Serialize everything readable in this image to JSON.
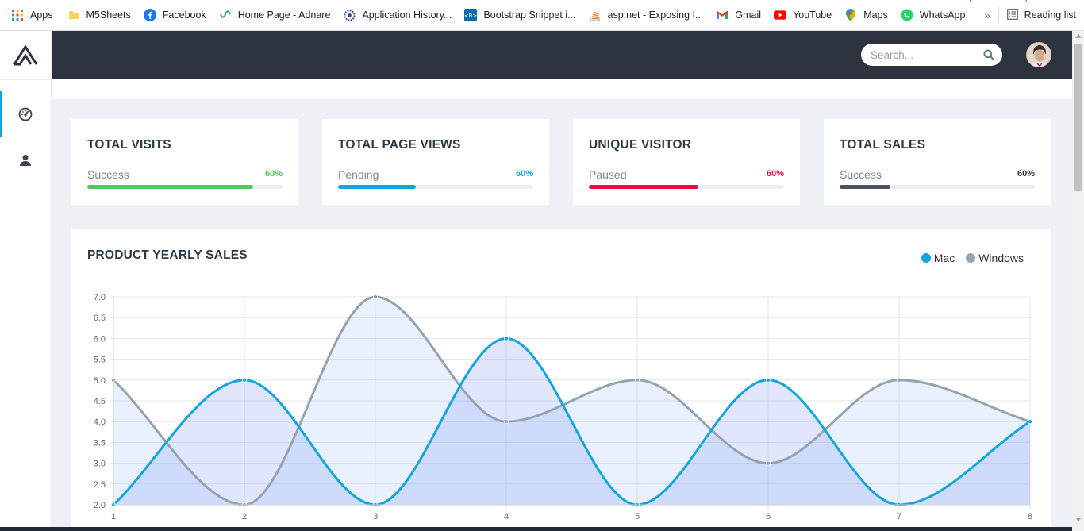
{
  "bookmarks": {
    "items": [
      {
        "label": "Apps",
        "icon": "apps-grid-icon"
      },
      {
        "label": "M5Sheets",
        "icon": "folder-icon"
      },
      {
        "label": "Facebook",
        "icon": "facebook-icon"
      },
      {
        "label": "Home Page - Adnare",
        "icon": "adnare-icon"
      },
      {
        "label": "Application History...",
        "icon": "settings-wheel-icon"
      },
      {
        "label": "Bootstrap Snippet i...",
        "icon": "bootstrap-icon"
      },
      {
        "label": "asp.net - Exposing I...",
        "icon": "stackoverflow-icon"
      },
      {
        "label": "Gmail",
        "icon": "gmail-icon"
      },
      {
        "label": "YouTube",
        "icon": "youtube-icon"
      },
      {
        "label": "Maps",
        "icon": "maps-icon"
      },
      {
        "label": "WhatsApp",
        "icon": "whatsapp-icon"
      }
    ],
    "more_label": "»",
    "reading_list": "Reading list"
  },
  "topnav": {
    "search_placeholder": "Search..."
  },
  "cards": [
    {
      "title": "TOTAL VISITS",
      "status": "Success",
      "percent_label": "60%",
      "fill_fraction": 0.85,
      "color": "#56c75a"
    },
    {
      "title": "TOTAL PAGE VIEWS",
      "status": "Pending",
      "percent_label": "60%",
      "fill_fraction": 0.4,
      "color": "#12a5dc"
    },
    {
      "title": "UNIQUE VISITOR",
      "status": "Paused",
      "percent_label": "60%",
      "fill_fraction": 0.56,
      "color": "#ee0a43"
    },
    {
      "title": "TOTAL SALES",
      "status": "Success",
      "percent_label": "60%",
      "fill_fraction": 0.26,
      "color": "#4a5260"
    }
  ],
  "chart_card": {
    "title": "PRODUCT YEARLY SALES"
  },
  "chart_data": {
    "type": "line",
    "title": "PRODUCT YEARLY SALES",
    "x": [
      1,
      2,
      3,
      4,
      5,
      6,
      7,
      8
    ],
    "series": [
      {
        "name": "Mac",
        "values": [
          2,
          5,
          2,
          6,
          2,
          5,
          2,
          4
        ],
        "color": "#12a5dc"
      },
      {
        "name": "Windows",
        "values": [
          5,
          2,
          7,
          4,
          5,
          3,
          5,
          4
        ],
        "color": "#95a3ac"
      }
    ],
    "ylim": [
      2.0,
      7.0
    ],
    "y_ticks": [
      "2.0",
      "2.5",
      "3.0",
      "3.5",
      "4.0",
      "4.5",
      "5.0",
      "5.5",
      "6.0",
      "6.5",
      "7.0"
    ],
    "x_ticks": [
      "1",
      "2",
      "3",
      "4",
      "5",
      "6",
      "7",
      "8"
    ],
    "grid": true,
    "smooth": true,
    "filled": true,
    "legend": "top-right"
  }
}
